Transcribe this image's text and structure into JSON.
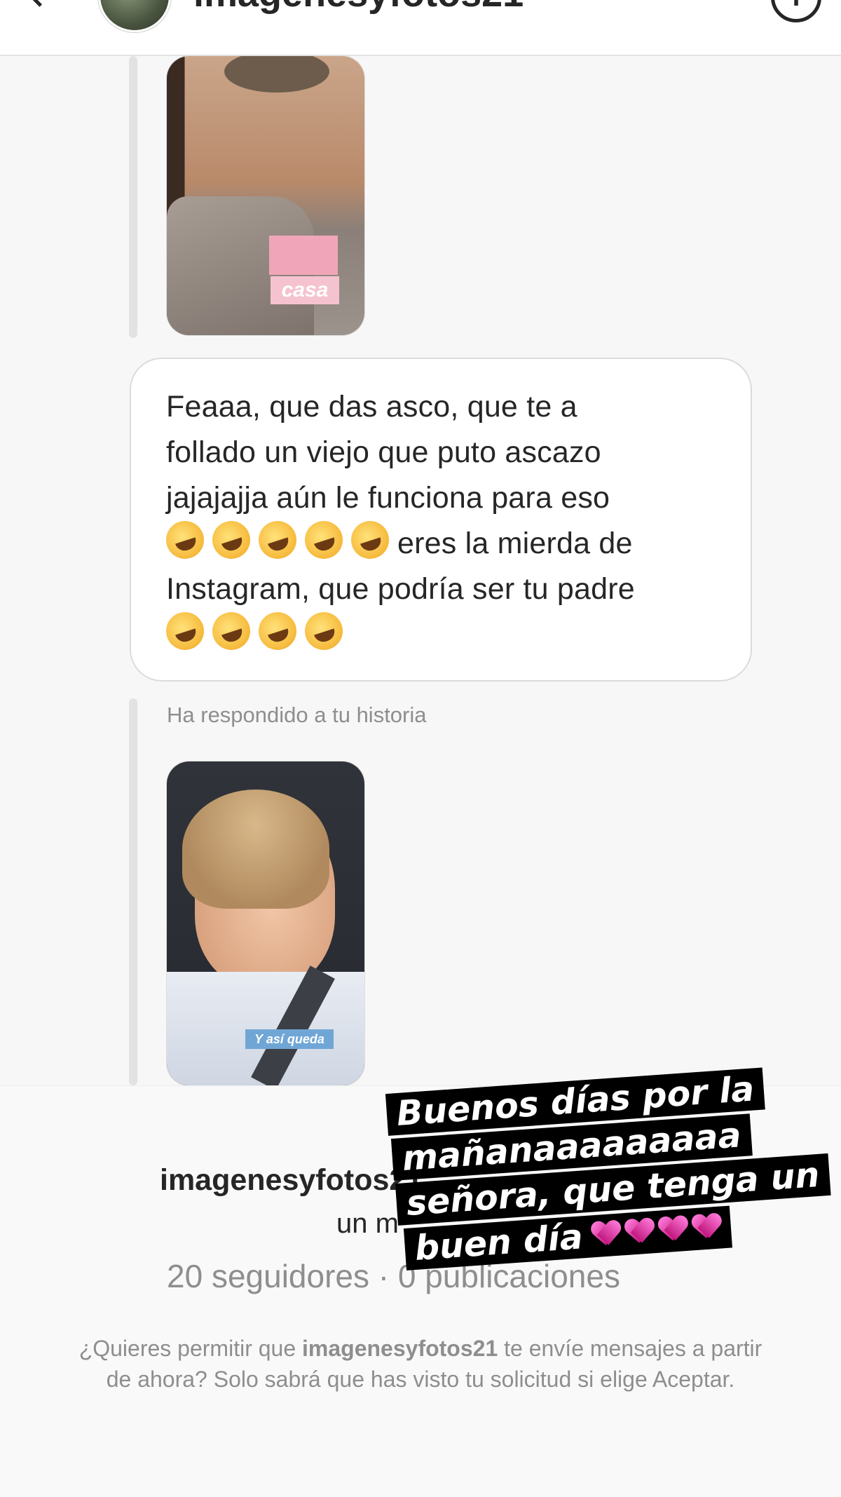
{
  "header": {
    "username": "imagenesyfotos21",
    "info_glyph": "i"
  },
  "story_reply_1": {
    "sticker_text": "casa"
  },
  "message": {
    "line1": "Feaaa, que das asco, que te a",
    "line2": "follado un viejo que puto ascazo",
    "line3": "jajajajja aún le funciona para eso",
    "line4_text": "eres la mierda de",
    "line5": "Instagram, que podría ser tu padre",
    "emoji_name": "rolling-on-floor-laughing-icon"
  },
  "story_reply_2": {
    "caption": "Ha respondido a tu historia",
    "sticker_text": "Y así queda"
  },
  "request": {
    "username": "imagenesyfotos21",
    "subtitle": "un m",
    "stats": "20 seguidores · 0 publicaciones",
    "message_prefix": "¿Quieres permitir que ",
    "message_username": "imagenesyfotos21",
    "message_suffix": " te envíe mensajes a partir de ahora? Solo sabrá que has visto tu solicitud si elige Aceptar."
  },
  "overlay": {
    "line1": "Buenos días por la",
    "line2": "mañanaaaaaaaaa",
    "line3": "señora, que tenga un",
    "line4": "buen día",
    "heart_icon": "sparkling-heart-icon"
  }
}
